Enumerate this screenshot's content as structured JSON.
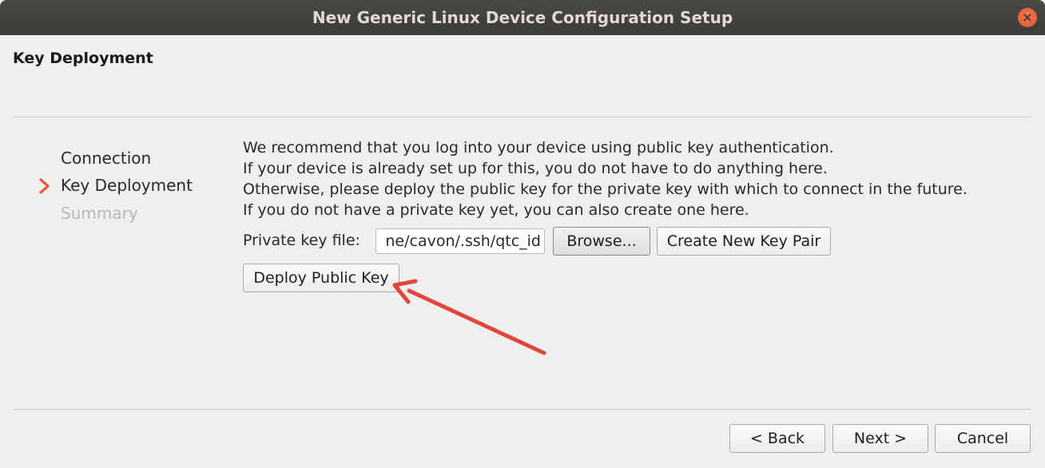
{
  "window": {
    "title": "New Generic Linux Device Configuration Setup",
    "close_icon": "close-icon"
  },
  "page": {
    "title": "Key Deployment"
  },
  "steps": [
    {
      "label": "Connection",
      "state": "done"
    },
    {
      "label": "Key Deployment",
      "state": "current"
    },
    {
      "label": "Summary",
      "state": "disabled"
    }
  ],
  "description": {
    "lines": [
      "We recommend that you log into your device using public key authentication.",
      "If your device is already set up for this, you do not have to do anything here.",
      "Otherwise, please deploy the public key for the private key with which to connect in the future.",
      "If you do not have a private key yet, you can also create one here."
    ]
  },
  "private_key": {
    "label": "Private key file:",
    "value": "ne/cavon/.ssh/qtc_id"
  },
  "buttons": {
    "browse": "Browse...",
    "create": "Create New Key Pair",
    "deploy": "Deploy Public Key",
    "back": "< Back",
    "next": "Next >",
    "cancel": "Cancel"
  },
  "colors": {
    "titlebar": "#3c3b37",
    "close": "#e95420",
    "step_arrow": "#e95420",
    "annotation_arrow": "#e0463a"
  }
}
